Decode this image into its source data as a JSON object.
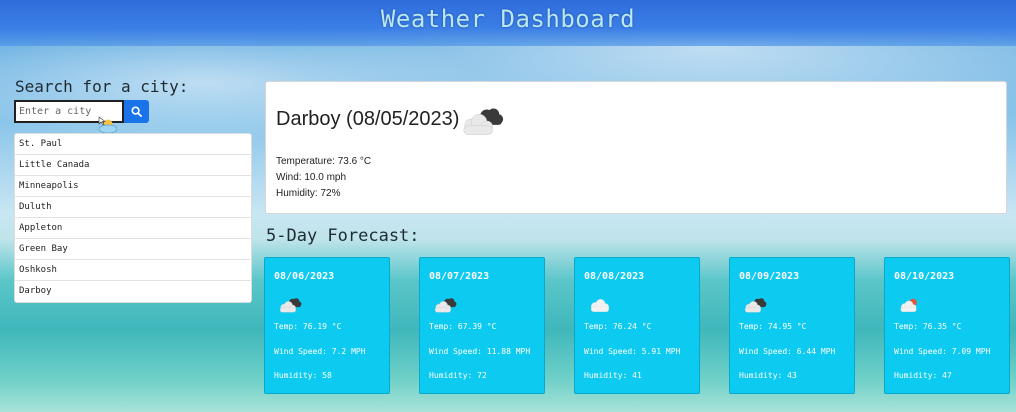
{
  "header": {
    "title": "Weather Dashboard"
  },
  "search": {
    "label": "Search for a city:",
    "placeholder": "Enter a city"
  },
  "history": [
    {
      "label": "St. Paul"
    },
    {
      "label": "Little Canada"
    },
    {
      "label": "Minneapolis"
    },
    {
      "label": "Duluth"
    },
    {
      "label": "Appleton"
    },
    {
      "label": "Green Bay"
    },
    {
      "label": "Oshkosh"
    },
    {
      "label": "Darboy"
    }
  ],
  "current": {
    "title": "Darboy (08/05/2023)",
    "icon": "broken-clouds-icon",
    "temperature": "Temperature: 73.6 °C",
    "wind": "Wind: 10.0 mph",
    "humidity": "Humidity: 72%"
  },
  "forecast": {
    "title": "5-Day Forecast:",
    "days": [
      {
        "date": "08/06/2023",
        "icon": "broken-clouds-icon",
        "temp": "Temp: 76.19 °C",
        "wind": "Wind Speed: 7.2 MPH",
        "humidity": "Humidity: 58"
      },
      {
        "date": "08/07/2023",
        "icon": "broken-clouds-icon",
        "temp": "Temp: 67.39 °C",
        "wind": "Wind Speed: 11.88 MPH",
        "humidity": "Humidity: 72"
      },
      {
        "date": "08/08/2023",
        "icon": "overcast-clouds-icon",
        "temp": "Temp: 76.24 °C",
        "wind": "Wind Speed: 5.91 MPH",
        "humidity": "Humidity: 41"
      },
      {
        "date": "08/09/2023",
        "icon": "broken-clouds-icon",
        "temp": "Temp: 74.95 °C",
        "wind": "Wind Speed: 6.44 MPH",
        "humidity": "Humidity: 43"
      },
      {
        "date": "08/10/2023",
        "icon": "few-clouds-icon",
        "temp": "Temp: 76.35 °C",
        "wind": "Wind Speed: 7.09 MPH",
        "humidity": "Humidity: 47"
      }
    ]
  },
  "colors": {
    "header": "#3b7ee6",
    "search_button": "#1a73e8",
    "forecast_card": "#0dcaf0"
  }
}
